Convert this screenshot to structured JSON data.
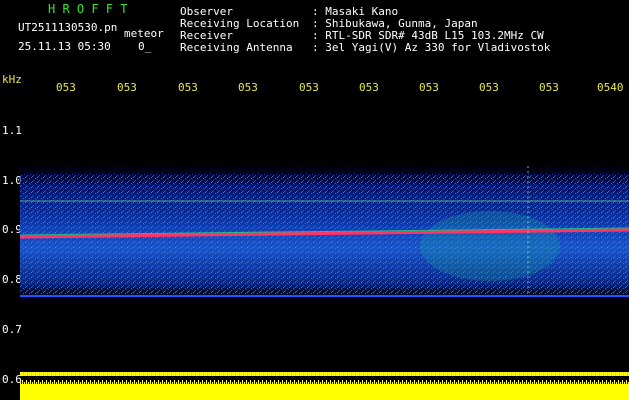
{
  "header": {
    "app_name": "H R O F F T",
    "filename": "UT2511130530.pn",
    "meteor_label": "meteor",
    "datetime": "25.11.13 05:30",
    "count": "0_",
    "info_labels": [
      "Observer",
      "Receiving Location",
      "Receiver",
      "Receiving Antenna"
    ],
    "info_values": [
      ": Masaki Kano",
      ": Shibukawa, Gunma, Japan",
      ": RTL-SDR SDR# 43dB L15 103.2MHz CW",
      ": 3el Yagi(V) Az 330 for Vladivostok"
    ]
  },
  "axes": {
    "y_unit": "kHz",
    "y_ticks": [
      "1.1",
      "1.0",
      "0.9",
      "0.8",
      "0.7",
      "0.6"
    ],
    "x_ticks": [
      "053",
      "053",
      "053",
      "053",
      "053",
      "053",
      "053",
      "053",
      "053",
      "0540"
    ]
  },
  "colors": {
    "background": "#000000",
    "grid": "#55ccaa",
    "signal_line": "#ff3366",
    "echo_band": "#00ffee",
    "noise_floor": "#ffff00",
    "text_axis": "#e8e84a",
    "text_title": "#2ee82e"
  }
}
